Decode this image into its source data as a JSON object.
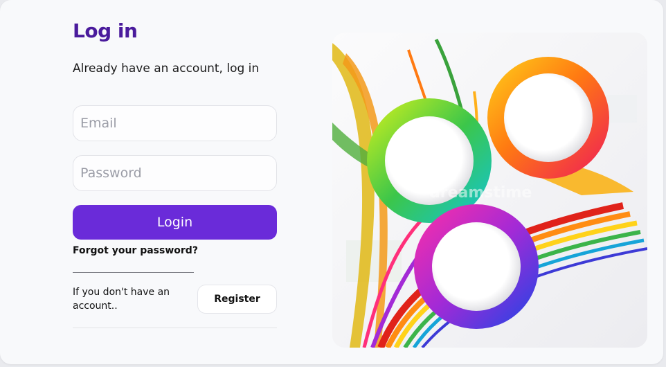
{
  "login": {
    "title": "Log in",
    "subtitle": "Already have an account, log in",
    "email_placeholder": "Email",
    "password_placeholder": "Password",
    "login_label": "Login",
    "forgot_label": "Forgot your password?",
    "no_account_text": "If you don't have an account..",
    "register_label": "Register"
  },
  "hero": {
    "watermark": "dreamstime"
  },
  "colors": {
    "title": "#4a1b9c",
    "primary_button": "#6a2bd9",
    "background": "#f8f9fb"
  }
}
